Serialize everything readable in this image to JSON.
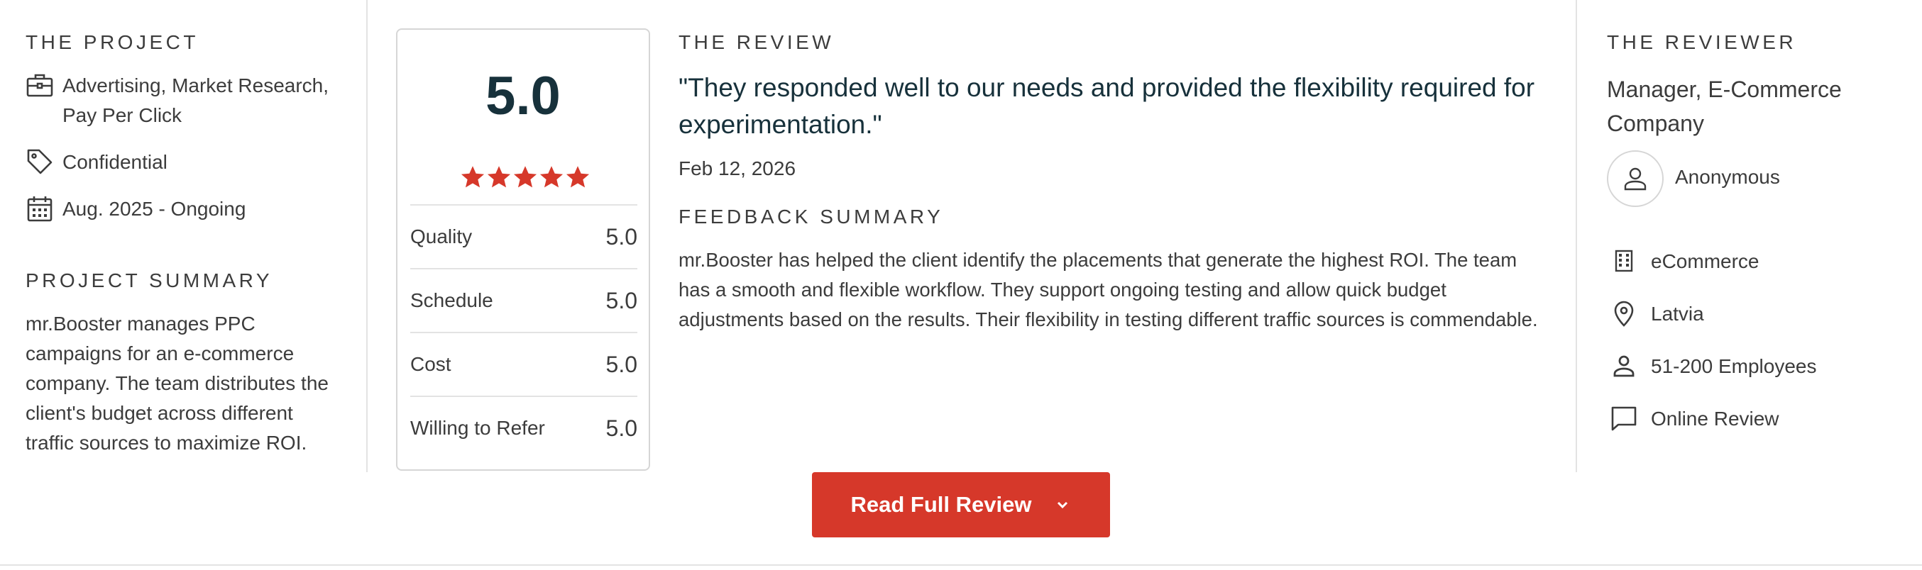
{
  "project": {
    "heading": "THE PROJECT",
    "services": "Advertising, Market Research,",
    "services_line2": "Pay Per Click",
    "budget": "Confidential",
    "timeline": "Aug. 2025 - Ongoing",
    "summary_heading": "PROJECT SUMMARY",
    "summary_text": "mr.Booster manages PPC campaigns for an e-commerce company. The team distributes the client's budget across different traffic sources to maximize ROI."
  },
  "rating": {
    "overall": "5.0",
    "stars": 5,
    "star_color": "#d6382a",
    "rows": [
      {
        "label": "Quality",
        "value": "5.0"
      },
      {
        "label": "Schedule",
        "value": "5.0"
      },
      {
        "label": "Cost",
        "value": "5.0"
      },
      {
        "label": "Willing to Refer",
        "value": "5.0"
      }
    ]
  },
  "review": {
    "heading": "THE REVIEW",
    "quote": "\"They responded well to our needs and provided the flexibility required for experimentation.\"",
    "date": "Feb 12, 2026",
    "feedback_heading": "FEEDBACK SUMMARY",
    "feedback_text": "mr.Booster has helped the client identify the placements that generate the highest ROI. The team has a smooth and flexible workflow. They support ongoing testing and allow quick budget adjustments based on the results. Their flexibility in testing different traffic sources is commendable."
  },
  "reviewer": {
    "heading": "THE REVIEWER",
    "title": "Manager, E-Commerce Company",
    "name": "Anonymous",
    "industry": "eCommerce",
    "location": "Latvia",
    "size": "51-200 Employees",
    "source": "Online Review"
  },
  "actions": {
    "read_full_label": "Read Full Review",
    "button_color": "#d6382a"
  }
}
